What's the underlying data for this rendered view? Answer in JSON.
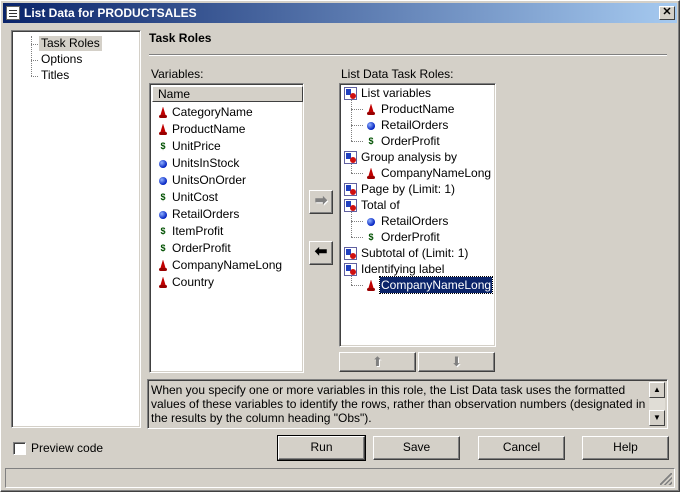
{
  "window": {
    "title": "List Data for PRODUCTSALES",
    "close_label": "✕"
  },
  "nav": {
    "items": [
      {
        "label": "Task Roles",
        "selected": true
      },
      {
        "label": "Options",
        "selected": false
      },
      {
        "label": "Titles",
        "selected": false
      }
    ]
  },
  "section_title": "Task Roles",
  "variables": {
    "label": "Variables:",
    "column_header": "Name",
    "items": [
      {
        "name": "CategoryName",
        "type": "char-icon"
      },
      {
        "name": "ProductName",
        "type": "char-icon"
      },
      {
        "name": "UnitPrice",
        "type": "currency-icon"
      },
      {
        "name": "UnitsInStock",
        "type": "numeric-icon"
      },
      {
        "name": "UnitsOnOrder",
        "type": "numeric-icon"
      },
      {
        "name": "UnitCost",
        "type": "currency-icon"
      },
      {
        "name": "RetailOrders",
        "type": "numeric-icon"
      },
      {
        "name": "ItemProfit",
        "type": "currency-icon"
      },
      {
        "name": "OrderProfit",
        "type": "currency-icon"
      },
      {
        "name": "CompanyNameLong",
        "type": "char-icon"
      },
      {
        "name": "Country",
        "type": "char-icon"
      }
    ]
  },
  "roles": {
    "label": "List Data Task Roles:",
    "items": [
      {
        "role": "List variables",
        "children": [
          {
            "name": "ProductName",
            "type": "char-icon"
          },
          {
            "name": "RetailOrders",
            "type": "numeric-icon"
          },
          {
            "name": "OrderProfit",
            "type": "currency-icon"
          }
        ]
      },
      {
        "role": "Group analysis by",
        "children": [
          {
            "name": "CompanyNameLong",
            "type": "char-icon"
          }
        ]
      },
      {
        "role": "Page by  (Limit: 1)",
        "children": []
      },
      {
        "role": "Total of",
        "children": [
          {
            "name": "RetailOrders",
            "type": "numeric-icon"
          },
          {
            "name": "OrderProfit",
            "type": "currency-icon"
          }
        ]
      },
      {
        "role": "Subtotal of  (Limit: 1)",
        "children": []
      },
      {
        "role": "Identifying label",
        "children": [
          {
            "name": "CompanyNameLong",
            "type": "char-icon",
            "selected": true
          }
        ]
      }
    ]
  },
  "arrows": {
    "add": "➡",
    "remove": "⬅",
    "move_up": "⬆",
    "move_down": "⬇"
  },
  "help_text": "When you specify one or more variables in this role, the List Data task uses the formatted values of these variables to identify the rows, rather than observation numbers (designated in the results by the column heading \"Obs\").",
  "preview_code_label": "Preview code",
  "buttons": {
    "run": "Run",
    "save": "Save",
    "cancel": "Cancel",
    "help": "Help"
  },
  "currency_glyph": "$"
}
